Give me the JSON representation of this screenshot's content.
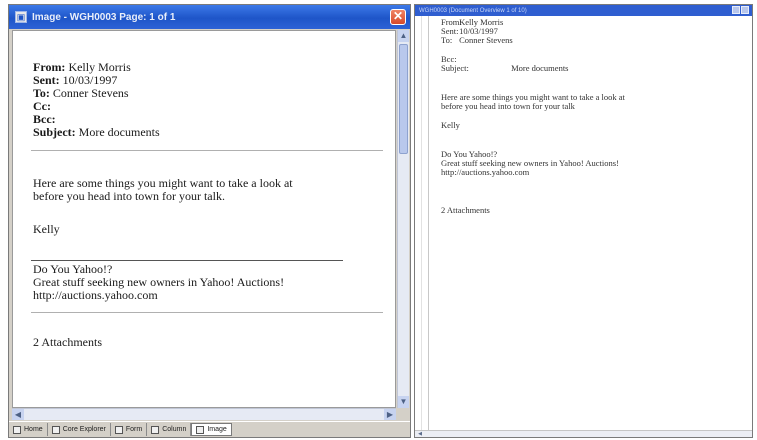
{
  "left_window": {
    "title": "Image - WGH0003 Page: 1 of 1",
    "close_glyph": "✕",
    "email": {
      "from_label": "From:",
      "from_value": "Kelly Morris",
      "sent_label": "Sent:",
      "sent_value": "10/03/1997",
      "to_label": "To:",
      "to_value": "Conner Stevens",
      "cc_label": "Cc:",
      "bcc_label": "Bcc:",
      "subject_label": "Subject:",
      "subject_value": "More documents",
      "body_line_1": "Here are some things you might want to take a look at",
      "body_line_2": "before you head into town for your talk.",
      "signature": "Kelly",
      "ad_line_1": "Do You Yahoo!?",
      "ad_line_2": "Great stuff seeking new owners in Yahoo! Auctions!",
      "ad_line_3": "http://auctions.yahoo.com",
      "attachments": "2 Attachments"
    },
    "tabs": [
      {
        "label": "Home",
        "icon": "home-icon"
      },
      {
        "label": "Core Explorer",
        "icon": "explorer-icon"
      },
      {
        "label": "Form",
        "icon": "form-icon"
      },
      {
        "label": "Column",
        "icon": "column-icon"
      },
      {
        "label": "Image",
        "icon": "image-icon"
      }
    ]
  },
  "right_window": {
    "title": "WGH0003 (Document Overview 1 of 10)",
    "email": {
      "from_label": "From:",
      "from_value": "Kelly Morris",
      "sent_label": "Sent:",
      "sent_value": "10/03/1997",
      "to_label": "To:",
      "to_value": "Conner Stevens",
      "bcc_label": "Bcc:",
      "subject_label": "Subject:",
      "subject_value": "More documents",
      "body_line_1": "Here are some things you might want to take a look at",
      "body_line_2": "before you head into town for your talk",
      "signature": "Kelly",
      "ad_line_1": "Do You Yahoo!?",
      "ad_line_2": "Great stuff seeking new owners in Yahoo! Auctions!",
      "ad_line_3": "http://auctions.yahoo.com",
      "attachments": "2 Attachments"
    }
  }
}
